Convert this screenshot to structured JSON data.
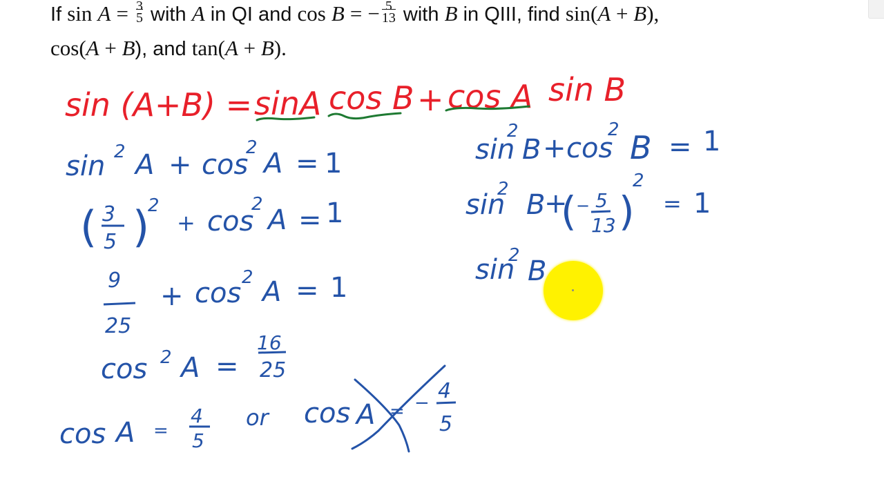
{
  "problem": {
    "line1": {
      "t_if": "If",
      "sin": "sin",
      "A": "A",
      "eq": "=",
      "fracA_num": "3",
      "fracA_den": "5",
      "t_with": "with",
      "A2": "A",
      "t_inQI": "in QI and",
      "cos": "cos",
      "B": "B",
      "eq2": "=",
      "minus": "−",
      "fracB_num": "5",
      "fracB_den": "13",
      "t_with2": "with",
      "B2": "B",
      "t_inQIII": "in QIII, find",
      "sinAB": "sin(",
      "AB_A": "A",
      "AB_plus": " + ",
      "AB_B": "B",
      "AB_close": "),"
    },
    "line2": {
      "cosAB": "cos(",
      "A": "A",
      "plus": " + ",
      "B": "B",
      "close": "), and ",
      "tanAB": "tan(",
      "A2": "A",
      "plus2": " + ",
      "B2": "B",
      "close2": ")."
    }
  },
  "colors": {
    "red_ink": "#e8202a",
    "green_ink": "#1e7a32",
    "blue_ink": "#2453a8",
    "pointer": "#fff200"
  },
  "handwriting": {
    "formula": {
      "lhs": "sin (A+B) =",
      "term1a": "sinA",
      "term1b": "cos B",
      "plus": "+",
      "term2a": "cos A",
      "term2b": "sin B"
    },
    "left_steps": [
      {
        "id": "identity_A",
        "text": "sin²A + cos²A = 1"
      },
      {
        "id": "sub_A",
        "text": "(3/5)² + cos²A = 1"
      },
      {
        "id": "square_A",
        "text": "9/25 + cos²A = 1"
      },
      {
        "id": "solve_A",
        "text": "cos²A = 16/25"
      },
      {
        "id": "root_A",
        "text": "cos A = 4/5 or cos A = −4/5",
        "crossed_out": "cos A = −4/5"
      }
    ],
    "right_steps": [
      {
        "id": "identity_B",
        "text": "sin²B + cos²B = 1"
      },
      {
        "id": "sub_B",
        "text": "sin²B + (−5/13)² = 1"
      },
      {
        "id": "partial_B",
        "text": "sin²B"
      }
    ],
    "glyphs": {
      "sin": "sin",
      "cos": "cos",
      "two": "2",
      "A": "A",
      "B": "B",
      "plus": "+",
      "eq": "=",
      "one": "1",
      "three": "3",
      "five": "5",
      "nine": "9",
      "twentyfive": "25",
      "sixteen": "16",
      "four": "4",
      "thirteen": "13",
      "minus": "−",
      "or": "or",
      "lparen": "(",
      "rparen": ")"
    }
  }
}
